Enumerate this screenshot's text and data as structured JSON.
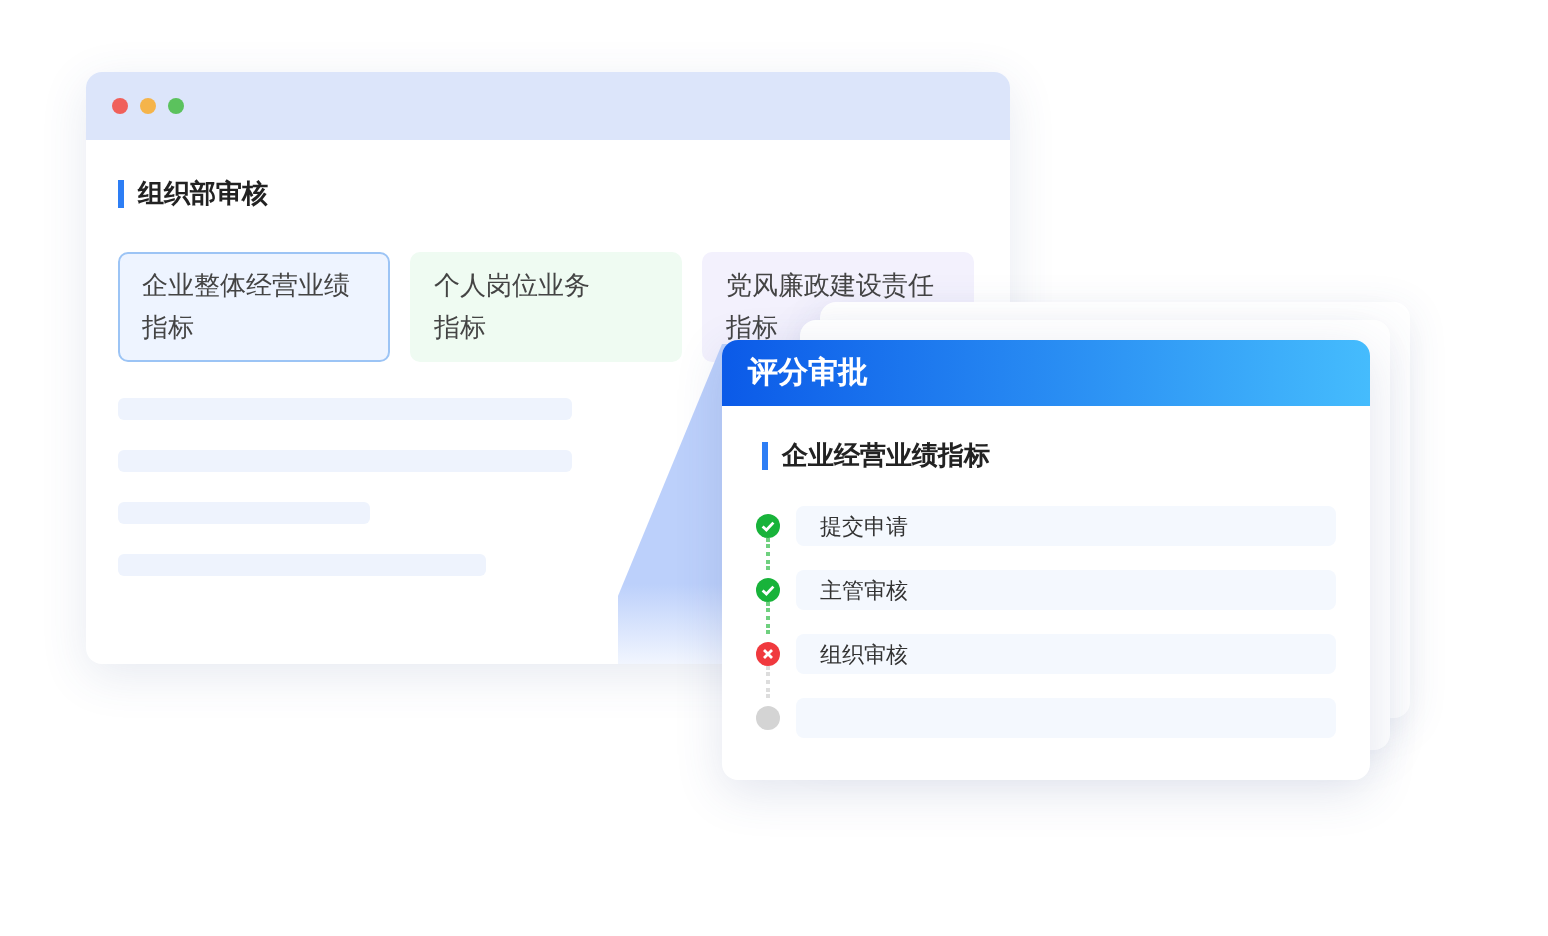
{
  "main_window": {
    "section_title": "组织部审核",
    "tiles": [
      {
        "label": "企业整体经营业绩指标",
        "selected": true,
        "color": "#eef4ff"
      },
      {
        "label": "个人岗位业务指标",
        "selected": false,
        "color": "#effbf2"
      },
      {
        "label": "党风廉政建设责任指标",
        "selected": false,
        "color": "#f3f1fd"
      }
    ]
  },
  "approval_card": {
    "title": "评分审批",
    "section_title": "企业经营业绩指标",
    "steps": [
      {
        "label": "提交申请",
        "kind": "done"
      },
      {
        "label": "主管审核",
        "kind": "done"
      },
      {
        "label": "组织审核",
        "kind": "rejected"
      },
      {
        "kind": "pending"
      }
    ]
  }
}
